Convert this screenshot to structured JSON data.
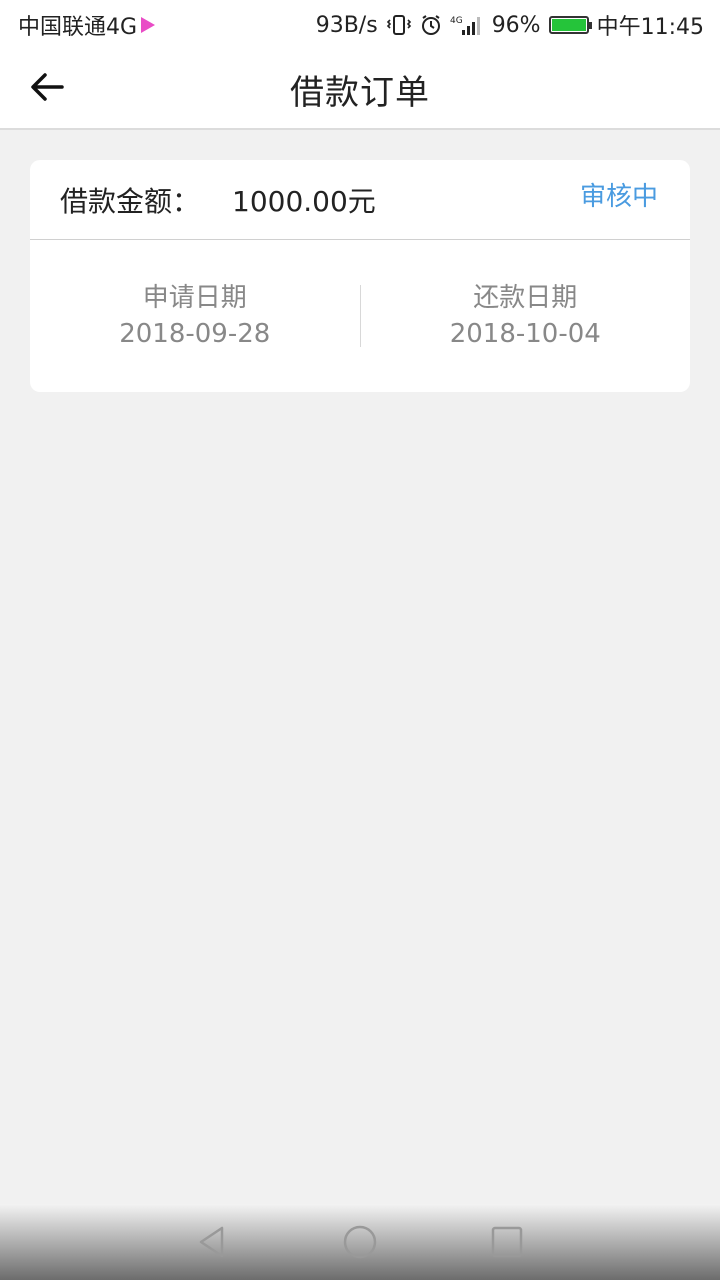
{
  "status_bar": {
    "carrier": "中国联通4G",
    "net_speed": "93B/s",
    "battery_percent": "96%",
    "time": "中午11:45",
    "icons": [
      "play-icon",
      "vibrate-icon",
      "alarm-icon",
      "signal-icon",
      "battery-icon"
    ],
    "colors": {
      "play": "#e94cc6",
      "battery": "#25c43a"
    }
  },
  "header": {
    "title": "借款订单",
    "back_icon": "arrow-left-icon"
  },
  "order": {
    "amount_label": "借款金额：",
    "amount_value": "1000.00元",
    "status": "审核中",
    "status_color": "#4a9be0",
    "apply_date_label": "申请日期",
    "apply_date": "2018-09-28",
    "repay_date_label": "还款日期",
    "repay_date": "2018-10-04"
  },
  "nav": {
    "icons": [
      "back-triangle-icon",
      "home-circle-icon",
      "recents-square-icon"
    ]
  }
}
